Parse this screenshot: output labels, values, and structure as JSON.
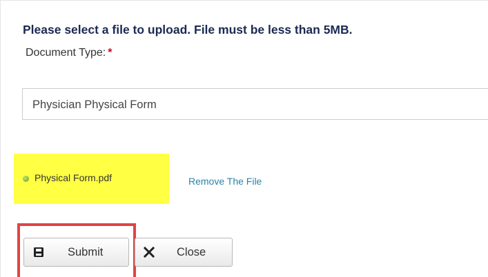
{
  "form": {
    "instructions": "Please select a file to upload. File must be less than 5MB.",
    "document_type_label": "Document Type:",
    "required_marker": "*",
    "document_type_value": "Physician Physical Form"
  },
  "attachment": {
    "file_name": "Physical Form.pdf",
    "status_icon": "green-dot-icon",
    "remove_label": "Remove The File"
  },
  "actions": {
    "submit_label": "Submit",
    "submit_icon": "save-disk-icon",
    "close_label": "Close",
    "close_icon": "close-x-icon"
  },
  "colors": {
    "heading": "#1b2a52",
    "required": "#d0021b",
    "link": "#2a83a8",
    "highlight_yellow": "#ffff44",
    "highlight_red": "#e04444",
    "status_green": "#7fb536"
  }
}
